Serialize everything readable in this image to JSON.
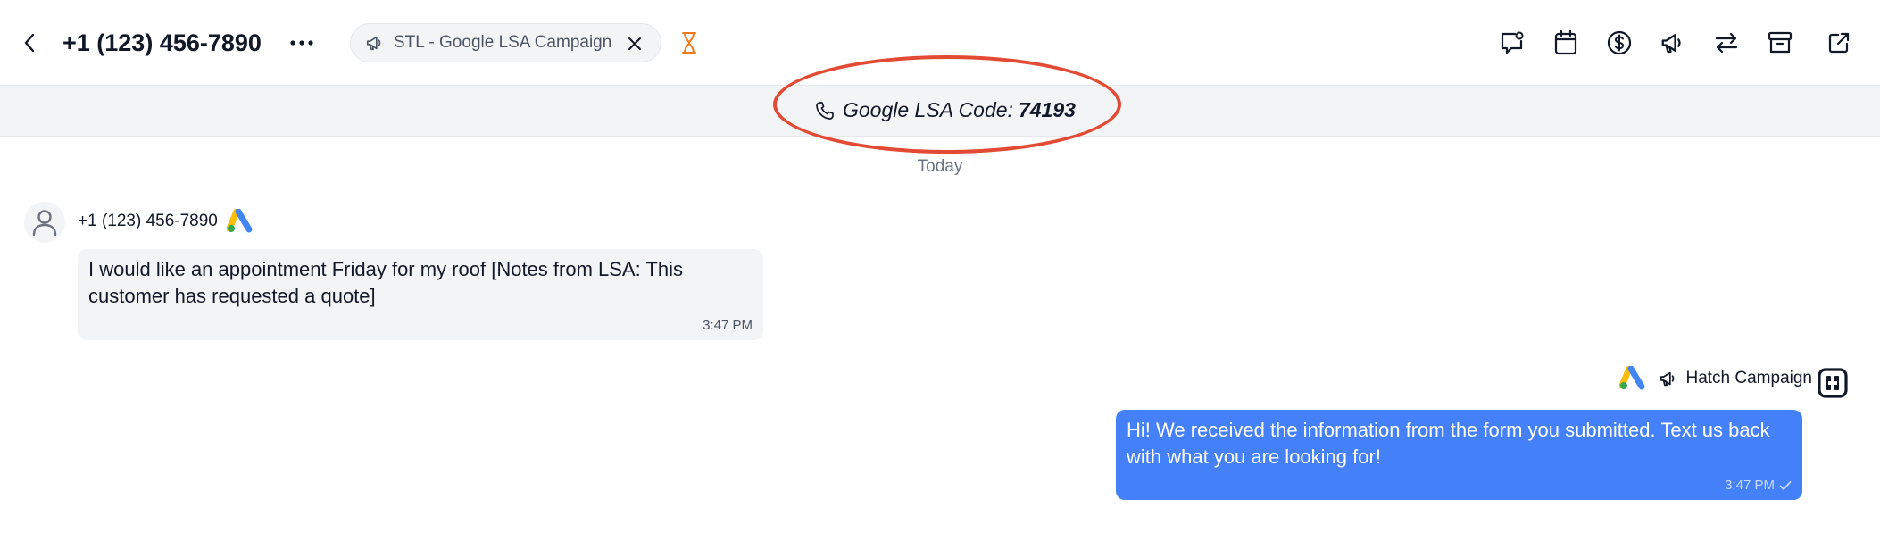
{
  "header": {
    "title": "+1 (123) 456-7890",
    "campaign_chip_label": "STL - Google LSA Campaign",
    "toolbar_icons": [
      "message-note-icon",
      "calendar-icon",
      "dollar-icon",
      "megaphone-icon",
      "transfer-icon",
      "archive-icon",
      "external-link-icon"
    ]
  },
  "banner": {
    "label": "Google LSA Code:",
    "code": "74193"
  },
  "conversation": {
    "day_label": "Today",
    "incoming": {
      "sender": "+1 (123) 456-7890",
      "text": "I would like an appointment Friday for my roof [Notes from LSA: This customer has requested a quote]",
      "time": "3:47 PM"
    },
    "outgoing": {
      "campaign_label": "Hatch Campaign",
      "text": "Hi! We received the information from the form you submitted. Text us back with what you are looking for!",
      "time": "3:47 PM"
    }
  },
  "colors": {
    "accent_blue": "#4480f7",
    "highlight_red": "#e34a33",
    "hourglass_orange": "#f07a1a"
  }
}
